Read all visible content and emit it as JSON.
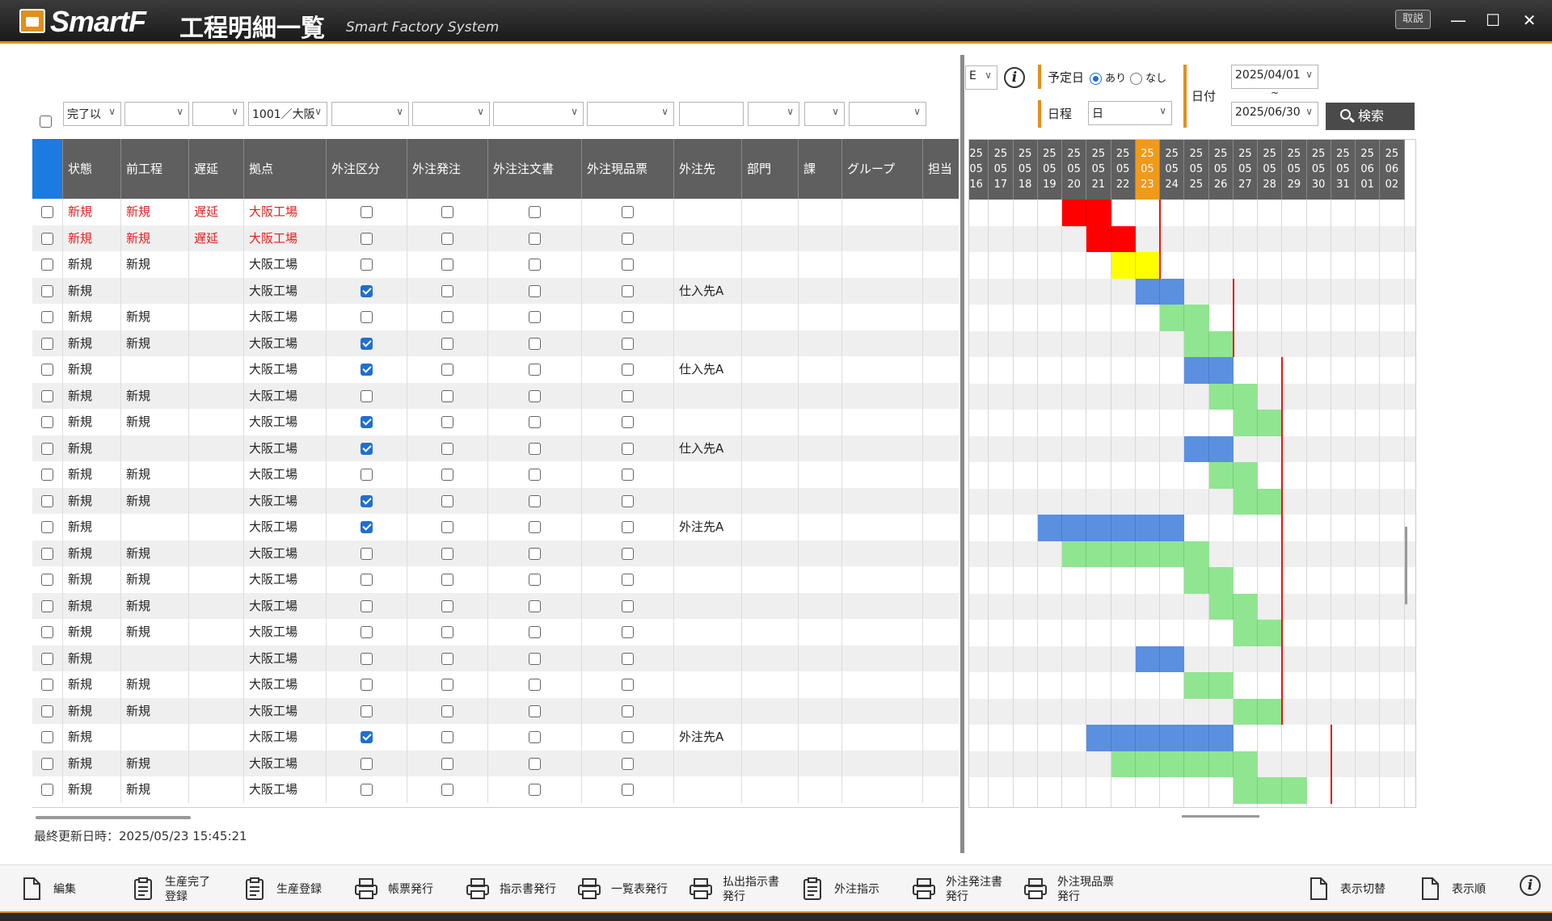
{
  "app": {
    "logo": "SmartF",
    "title": "工程明細一覧",
    "subtitle": "Smart Factory System",
    "manual_btn": "取説",
    "controls": {
      "minimize": "—",
      "maximize": "☐",
      "close": "✕"
    }
  },
  "filters": {
    "status": "完了以",
    "base": "1001／大阪"
  },
  "columns": [
    "状態",
    "前工程",
    "遅延",
    "拠点",
    "外注区分",
    "外注発注",
    "外注注文書",
    "外注現品票",
    "外注先",
    "部門",
    "課",
    "グループ",
    "担当"
  ],
  "rows": [
    {
      "status": "新規",
      "prev": "新規",
      "delay": "遅延",
      "base": "大阪工場",
      "red": true,
      "gaichu": false,
      "supplier": ""
    },
    {
      "status": "新規",
      "prev": "新規",
      "delay": "遅延",
      "base": "大阪工場",
      "red": true,
      "gaichu": false,
      "supplier": ""
    },
    {
      "status": "新規",
      "prev": "新規",
      "delay": "",
      "base": "大阪工場",
      "red": false,
      "gaichu": false,
      "supplier": ""
    },
    {
      "status": "新規",
      "prev": "",
      "delay": "",
      "base": "大阪工場",
      "red": false,
      "gaichu": true,
      "supplier": "仕入先A"
    },
    {
      "status": "新規",
      "prev": "新規",
      "delay": "",
      "base": "大阪工場",
      "red": false,
      "gaichu": false,
      "supplier": ""
    },
    {
      "status": "新規",
      "prev": "新規",
      "delay": "",
      "base": "大阪工場",
      "red": false,
      "gaichu": true,
      "supplier": ""
    },
    {
      "status": "新規",
      "prev": "",
      "delay": "",
      "base": "大阪工場",
      "red": false,
      "gaichu": true,
      "supplier": "仕入先A"
    },
    {
      "status": "新規",
      "prev": "新規",
      "delay": "",
      "base": "大阪工場",
      "red": false,
      "gaichu": false,
      "supplier": ""
    },
    {
      "status": "新規",
      "prev": "新規",
      "delay": "",
      "base": "大阪工場",
      "red": false,
      "gaichu": true,
      "supplier": ""
    },
    {
      "status": "新規",
      "prev": "",
      "delay": "",
      "base": "大阪工場",
      "red": false,
      "gaichu": true,
      "supplier": "仕入先A"
    },
    {
      "status": "新規",
      "prev": "新規",
      "delay": "",
      "base": "大阪工場",
      "red": false,
      "gaichu": false,
      "supplier": ""
    },
    {
      "status": "新規",
      "prev": "新規",
      "delay": "",
      "base": "大阪工場",
      "red": false,
      "gaichu": true,
      "supplier": ""
    },
    {
      "status": "新規",
      "prev": "",
      "delay": "",
      "base": "大阪工場",
      "red": false,
      "gaichu": true,
      "supplier": "外注先A"
    },
    {
      "status": "新規",
      "prev": "新規",
      "delay": "",
      "base": "大阪工場",
      "red": false,
      "gaichu": false,
      "supplier": ""
    },
    {
      "status": "新規",
      "prev": "新規",
      "delay": "",
      "base": "大阪工場",
      "red": false,
      "gaichu": false,
      "supplier": ""
    },
    {
      "status": "新規",
      "prev": "新規",
      "delay": "",
      "base": "大阪工場",
      "red": false,
      "gaichu": false,
      "supplier": ""
    },
    {
      "status": "新規",
      "prev": "新規",
      "delay": "",
      "base": "大阪工場",
      "red": false,
      "gaichu": false,
      "supplier": ""
    },
    {
      "status": "新規",
      "prev": "",
      "delay": "",
      "base": "大阪工場",
      "red": false,
      "gaichu": false,
      "supplier": ""
    },
    {
      "status": "新規",
      "prev": "新規",
      "delay": "",
      "base": "大阪工場",
      "red": false,
      "gaichu": false,
      "supplier": ""
    },
    {
      "status": "新規",
      "prev": "新規",
      "delay": "",
      "base": "大阪工場",
      "red": false,
      "gaichu": false,
      "supplier": ""
    },
    {
      "status": "新規",
      "prev": "",
      "delay": "",
      "base": "大阪工場",
      "red": false,
      "gaichu": true,
      "supplier": "外注先A"
    },
    {
      "status": "新規",
      "prev": "新規",
      "delay": "",
      "base": "大阪工場",
      "red": false,
      "gaichu": false,
      "supplier": ""
    },
    {
      "status": "新規",
      "prev": "新規",
      "delay": "",
      "base": "大阪工場",
      "red": false,
      "gaichu": false,
      "supplier": ""
    }
  ],
  "right_panel": {
    "yoteibi_label": "予定日",
    "ari": "あり",
    "nashi": "なし",
    "nittei_label": "日程",
    "nittei_value": "日",
    "date_label": "日付",
    "date_from": "2025/04/01",
    "tilde": "~",
    "date_to": "2025/06/30",
    "search": "検索",
    "partial_select": "E"
  },
  "gantt": {
    "dates": [
      [
        "25",
        "05",
        "16"
      ],
      [
        "25",
        "05",
        "17"
      ],
      [
        "25",
        "05",
        "18"
      ],
      [
        "25",
        "05",
        "19"
      ],
      [
        "25",
        "05",
        "20"
      ],
      [
        "25",
        "05",
        "21"
      ],
      [
        "25",
        "05",
        "22"
      ],
      [
        "25",
        "05",
        "23"
      ],
      [
        "25",
        "05",
        "24"
      ],
      [
        "25",
        "05",
        "25"
      ],
      [
        "25",
        "05",
        "26"
      ],
      [
        "25",
        "05",
        "27"
      ],
      [
        "25",
        "05",
        "28"
      ],
      [
        "25",
        "05",
        "29"
      ],
      [
        "25",
        "05",
        "30"
      ],
      [
        "25",
        "05",
        "31"
      ],
      [
        "25",
        "06",
        "01"
      ],
      [
        "25",
        "06",
        "02"
      ]
    ],
    "today_index": 7,
    "colors": {
      "red": "#ff0000",
      "yellow": "#ffff00",
      "blue": "#5b8fe0",
      "green": "#90e590",
      "deadline": "#e01818"
    },
    "bars": [
      {
        "row": 0,
        "start": 4,
        "len": 2,
        "color": "red"
      },
      {
        "row": 1,
        "start": 5,
        "len": 2,
        "color": "red"
      },
      {
        "row": 2,
        "start": 6,
        "len": 2,
        "color": "yellow"
      },
      {
        "row": 3,
        "start": 7,
        "len": 2,
        "color": "blue"
      },
      {
        "row": 4,
        "start": 8,
        "len": 2,
        "color": "green"
      },
      {
        "row": 5,
        "start": 9,
        "len": 2,
        "color": "green"
      },
      {
        "row": 6,
        "start": 9,
        "len": 2,
        "color": "blue"
      },
      {
        "row": 7,
        "start": 10,
        "len": 2,
        "color": "green"
      },
      {
        "row": 8,
        "start": 11,
        "len": 2,
        "color": "green"
      },
      {
        "row": 9,
        "start": 9,
        "len": 2,
        "color": "blue"
      },
      {
        "row": 10,
        "start": 10,
        "len": 2,
        "color": "green"
      },
      {
        "row": 11,
        "start": 11,
        "len": 2,
        "color": "green"
      },
      {
        "row": 12,
        "start": 3,
        "len": 6,
        "color": "blue"
      },
      {
        "row": 13,
        "start": 4,
        "len": 6,
        "color": "green"
      },
      {
        "row": 14,
        "start": 9,
        "len": 2,
        "color": "green"
      },
      {
        "row": 15,
        "start": 10,
        "len": 2,
        "color": "green"
      },
      {
        "row": 16,
        "start": 11,
        "len": 2,
        "color": "green"
      },
      {
        "row": 17,
        "start": 7,
        "len": 2,
        "color": "blue"
      },
      {
        "row": 18,
        "start": 9,
        "len": 2,
        "color": "green"
      },
      {
        "row": 19,
        "start": 11,
        "len": 2,
        "color": "green"
      },
      {
        "row": 20,
        "start": 5,
        "len": 6,
        "color": "blue"
      },
      {
        "row": 21,
        "start": 6,
        "len": 6,
        "color": "green"
      },
      {
        "row": 22,
        "start": 11,
        "len": 3,
        "color": "green"
      }
    ],
    "deadlines": [
      {
        "from_row": 0,
        "to_row": 2,
        "col": 8
      },
      {
        "from_row": 3,
        "to_row": 5,
        "col": 11
      },
      {
        "from_row": 6,
        "to_row": 19,
        "col": 13
      },
      {
        "from_row": 20,
        "to_row": 22,
        "col": 15
      }
    ]
  },
  "last_updated": "最終更新日時：2025/05/23 15:45:21",
  "toolbar": [
    {
      "name": "edit-button",
      "line1": "編集",
      "line2": "",
      "icon": "doc"
    },
    {
      "name": "production-complete-button",
      "line1": "生産完了",
      "line2": "登録",
      "icon": "clipboard"
    },
    {
      "name": "production-register-button",
      "line1": "生産登録",
      "line2": "",
      "icon": "clipboard"
    },
    {
      "name": "form-issue-button",
      "line1": "帳票発行",
      "line2": "",
      "icon": "printer"
    },
    {
      "name": "instruction-issue-button",
      "line1": "指示書発行",
      "line2": "",
      "icon": "printer"
    },
    {
      "name": "list-issue-button",
      "line1": "一覧表発行",
      "line2": "",
      "icon": "printer"
    },
    {
      "name": "payout-instruction-button",
      "line1": "払出指示書",
      "line2": "発行",
      "icon": "printer"
    },
    {
      "name": "outsourcing-instruction-button",
      "line1": "外注指示",
      "line2": "",
      "icon": "clipboard"
    },
    {
      "name": "outsourcing-order-button",
      "line1": "外注発注書",
      "line2": "発行",
      "icon": "printer"
    },
    {
      "name": "outsourcing-slip-button",
      "line1": "外注現品票",
      "line2": "発行",
      "icon": "printer"
    },
    {
      "name": "display-switch-button",
      "line1": "表示切替",
      "line2": "",
      "icon": "doc"
    },
    {
      "name": "display-order-button",
      "line1": "表示順",
      "line2": "",
      "icon": "doc"
    }
  ]
}
